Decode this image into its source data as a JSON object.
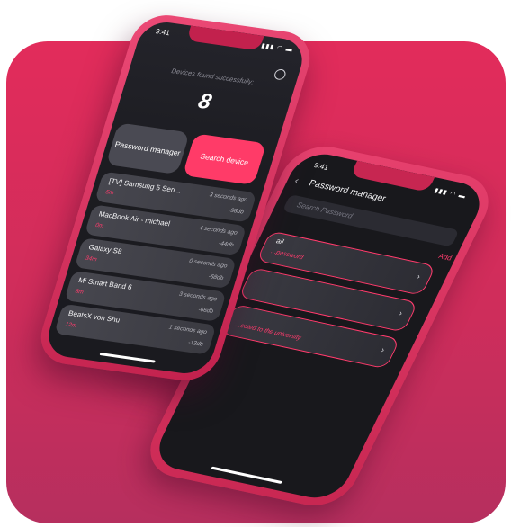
{
  "front_phone": {
    "time": "9:41",
    "status_icons": "▮▮▮ ◠ ▬",
    "found_text": "Devices found successfully:",
    "device_count": "8",
    "buttons": {
      "password_manager": "Password manager",
      "search_device": "Search device"
    },
    "devices": [
      {
        "name": "[TV] Samsung 5 Seri...",
        "distance": "5m",
        "time": "3 seconds ago",
        "signal": "-98db"
      },
      {
        "name": "MacBook Air - michael",
        "distance": "0m",
        "time": "4 seconds ago",
        "signal": "-44db"
      },
      {
        "name": "Galaxy S8",
        "distance": "34m",
        "time": "0 seconds ago",
        "signal": "-68db"
      },
      {
        "name": "Mi Smart Band 6",
        "distance": "8m",
        "time": "3 seconds ago",
        "signal": "-66db"
      },
      {
        "name": "BeatsX von Shu",
        "distance": "12m",
        "time": "1 seconds ago",
        "signal": "-13db"
      }
    ]
  },
  "back_phone": {
    "time": "9:41",
    "status_icons": "▮▮▮ ◠ ▬",
    "back_glyph": "‹",
    "title": "Password manager",
    "search_placeholder": "Search Password",
    "add_label": "Add",
    "entries": [
      {
        "label": "ail",
        "sub": "...password",
        "arrow": "›"
      },
      {
        "label": "",
        "sub": "",
        "arrow": "›"
      },
      {
        "label": "",
        "sub": "...ected to the university",
        "arrow": "›"
      }
    ]
  },
  "colors": {
    "accent": "#ff3c6d",
    "background_card": "#d92d5b",
    "screen": "#1c1c21"
  }
}
